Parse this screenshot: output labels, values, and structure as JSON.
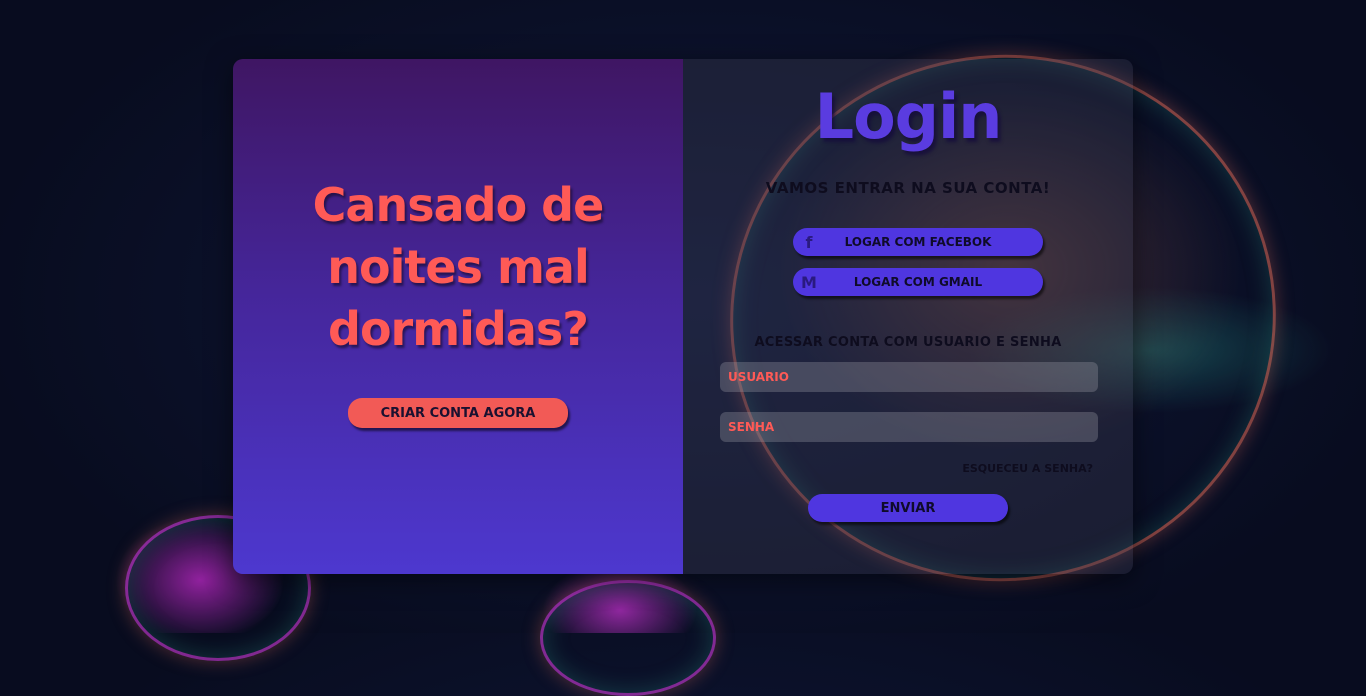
{
  "left_panel": {
    "headline_lines": [
      "Cansado de",
      "noites mal",
      "dormidas?"
    ],
    "create_account_label": "CRIAR CONTA AGORA"
  },
  "right_panel": {
    "title": "Login",
    "subtitle": "VAMOS ENTRAR NA SUA CONTA!",
    "facebook": {
      "icon": "facebook-icon",
      "glyph": "f",
      "label": "LOGAR COM FACEBOK"
    },
    "gmail": {
      "icon": "gmail-icon",
      "glyph": "M",
      "label": "LOGAR COM GMAIL"
    },
    "access_label": "ACESSAR CONTA COM USUARIO E SENHA",
    "username_placeholder": "USUARIO",
    "password_placeholder": "SENHA",
    "forgot_label": "ESQUECEU A SENHA?",
    "submit_label": "ENVIAR"
  },
  "colors": {
    "accent_coral": "#f25a56",
    "accent_purple": "#4f36e0",
    "left_gradient_top": "#3f1663",
    "left_gradient_bottom": "#4d38cf"
  }
}
